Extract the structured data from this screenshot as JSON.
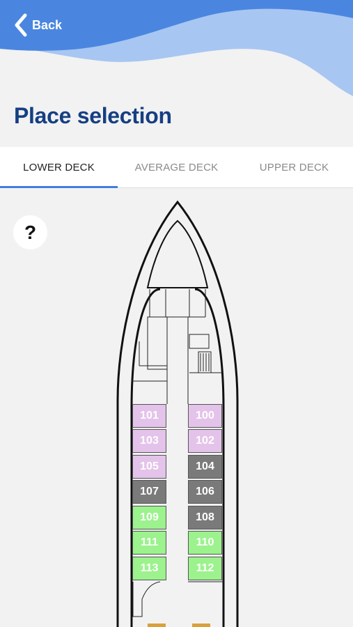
{
  "header": {
    "back_label": "Back",
    "title": "Place selection"
  },
  "tabs": [
    {
      "label": "LOWER DECK",
      "active": true
    },
    {
      "label": "AVERAGE DECK",
      "active": false
    },
    {
      "label": "UPPER DECK",
      "active": false
    }
  ],
  "help": {
    "label": "?"
  },
  "cabins": [
    {
      "number": "101",
      "status": "reserved"
    },
    {
      "number": "100",
      "status": "reserved"
    },
    {
      "number": "103",
      "status": "reserved"
    },
    {
      "number": "102",
      "status": "reserved"
    },
    {
      "number": "105",
      "status": "reserved"
    },
    {
      "number": "104",
      "status": "occupied"
    },
    {
      "number": "107",
      "status": "occupied"
    },
    {
      "number": "106",
      "status": "occupied"
    },
    {
      "number": "109",
      "status": "available"
    },
    {
      "number": "108",
      "status": "occupied"
    },
    {
      "number": "111",
      "status": "available"
    },
    {
      "number": "110",
      "status": "available"
    },
    {
      "number": "113",
      "status": "available"
    },
    {
      "number": "112",
      "status": "available"
    }
  ],
  "colors": {
    "header_blue": "#4a86e0",
    "header_light": "#a8c6f2",
    "title": "#163f82",
    "tab_indicator": "#3f7fd9",
    "reserved": "#e4c3ea",
    "occupied": "#7a7a7a",
    "available": "#9cf28d"
  }
}
